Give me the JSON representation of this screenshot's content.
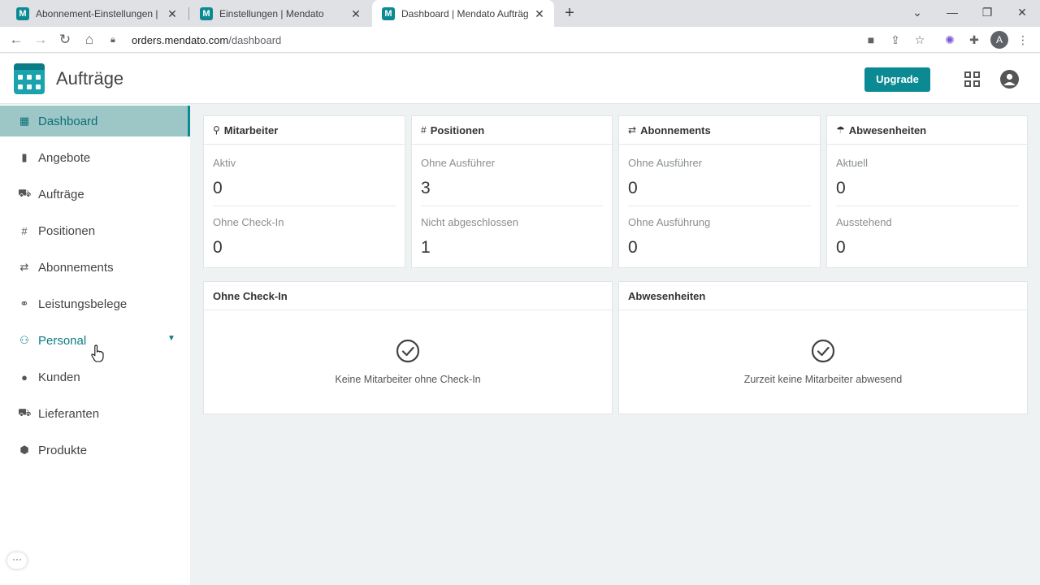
{
  "browser": {
    "tabs": [
      {
        "label": "Abonnement-Einstellungen | Men",
        "favicon": "M"
      },
      {
        "label": "Einstellungen | Mendato",
        "favicon": "M"
      },
      {
        "label": "Dashboard | Mendato Aufträge",
        "favicon": "M"
      }
    ],
    "url_host": "orders.mendato.com",
    "url_path": "/dashboard",
    "profile_initial": "A"
  },
  "header": {
    "title": "Aufträge",
    "upgrade_label": "Upgrade"
  },
  "sidebar": {
    "items": [
      {
        "label": "Dashboard",
        "icon": "dashboard-icon"
      },
      {
        "label": "Angebote",
        "icon": "document-icon"
      },
      {
        "label": "Aufträge",
        "icon": "cart-icon"
      },
      {
        "label": "Positionen",
        "icon": "hash-icon"
      },
      {
        "label": "Abonnements",
        "icon": "repeat-icon"
      },
      {
        "label": "Leistungsbelege",
        "icon": "handshake-icon"
      },
      {
        "label": "Personal",
        "icon": "people-icon"
      },
      {
        "label": "Kunden",
        "icon": "person-icon"
      },
      {
        "label": "Lieferanten",
        "icon": "truck-icon"
      },
      {
        "label": "Produkte",
        "icon": "box-icon"
      }
    ],
    "more_label": "···"
  },
  "stats": [
    {
      "title": "Mitarbeiter",
      "icon": "person-outline-icon",
      "rows": [
        {
          "label": "Aktiv",
          "value": "0"
        },
        {
          "label": "Ohne Check-In",
          "value": "0"
        }
      ]
    },
    {
      "title": "Positionen",
      "icon": "hash-icon",
      "rows": [
        {
          "label": "Ohne Ausführer",
          "value": "3"
        },
        {
          "label": "Nicht abgeschlossen",
          "value": "1"
        }
      ]
    },
    {
      "title": "Abonnements",
      "icon": "repeat-icon",
      "rows": [
        {
          "label": "Ohne Ausführer",
          "value": "0"
        },
        {
          "label": "Ohne Ausführung",
          "value": "0"
        }
      ]
    },
    {
      "title": "Abwesenheiten",
      "icon": "umbrella-icon",
      "rows": [
        {
          "label": "Aktuell",
          "value": "0"
        },
        {
          "label": "Ausstehend",
          "value": "0"
        }
      ]
    }
  ],
  "panels": [
    {
      "title": "Ohne Check-In",
      "message": "Keine Mitarbeiter ohne Check-In"
    },
    {
      "title": "Abwesenheiten",
      "message": "Zurzeit keine Mitarbeiter abwesend"
    }
  ],
  "colors": {
    "accent": "#0b8a94",
    "active_nav_bg": "#9dc6c6"
  }
}
